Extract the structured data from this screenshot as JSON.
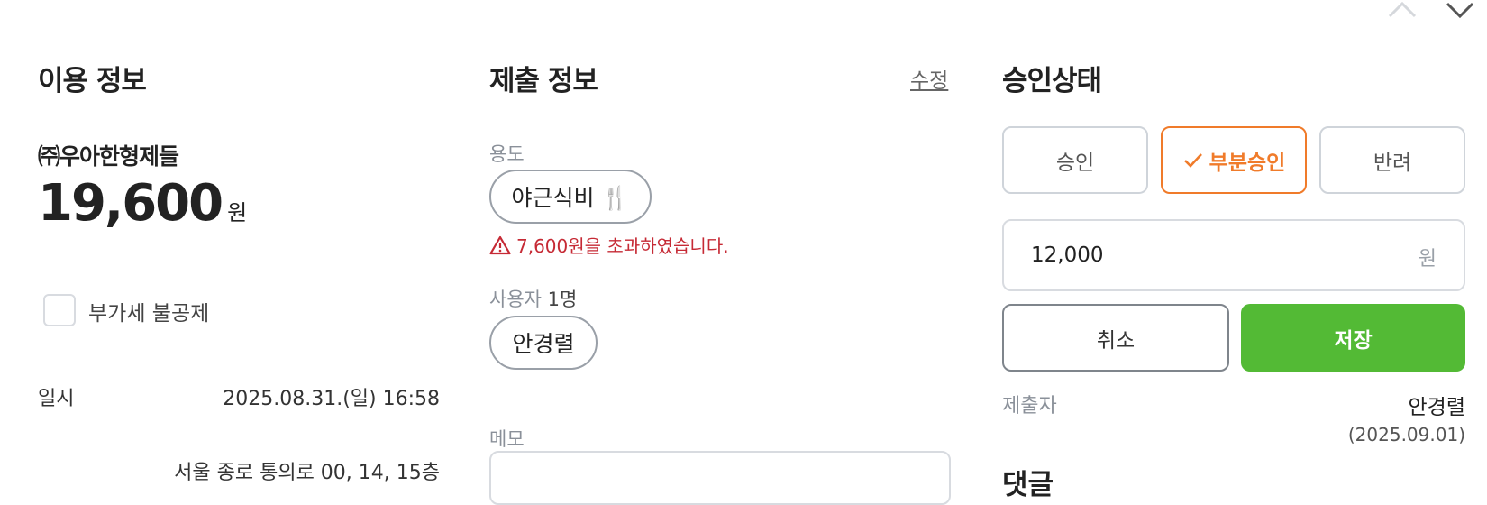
{
  "nav": {
    "prev_icon": "chevron-up-icon",
    "next_icon": "chevron-down-icon"
  },
  "usage": {
    "title": "이용 정보",
    "merchant": "㈜우아한형제들",
    "amount": "19,600",
    "amount_unit": "원",
    "vat_checkbox_label": "부가세 불공제",
    "vat_checked": false,
    "date_label": "일시",
    "date_value": "2025.08.31.(일) 16:58",
    "next_row_value": "서울 종로 통의로 00, 14, 15층"
  },
  "submission": {
    "title": "제출 정보",
    "edit_label": "수정",
    "purpose_label": "용도",
    "purpose_value": "야근식비 🍴",
    "warning_text": "7,600원을 초과하였습니다.",
    "users_label": "사용자",
    "users_count": "1명",
    "user_name": "안경렬",
    "memo_label": "메모"
  },
  "approval": {
    "title": "승인상태",
    "options": [
      "승인",
      "부분승인",
      "반려"
    ],
    "selected_index": 1,
    "amount_value": "12,000",
    "amount_unit": "원",
    "cancel_label": "취소",
    "save_label": "저장",
    "submitter_label": "제출자",
    "submitter_name": "안경렬",
    "submit_date": "(2025.09.01)",
    "comment_title": "댓글"
  },
  "colors": {
    "accent_orange": "#f07b2a",
    "save_green": "#53ba35",
    "warning_red": "#c62a35"
  }
}
